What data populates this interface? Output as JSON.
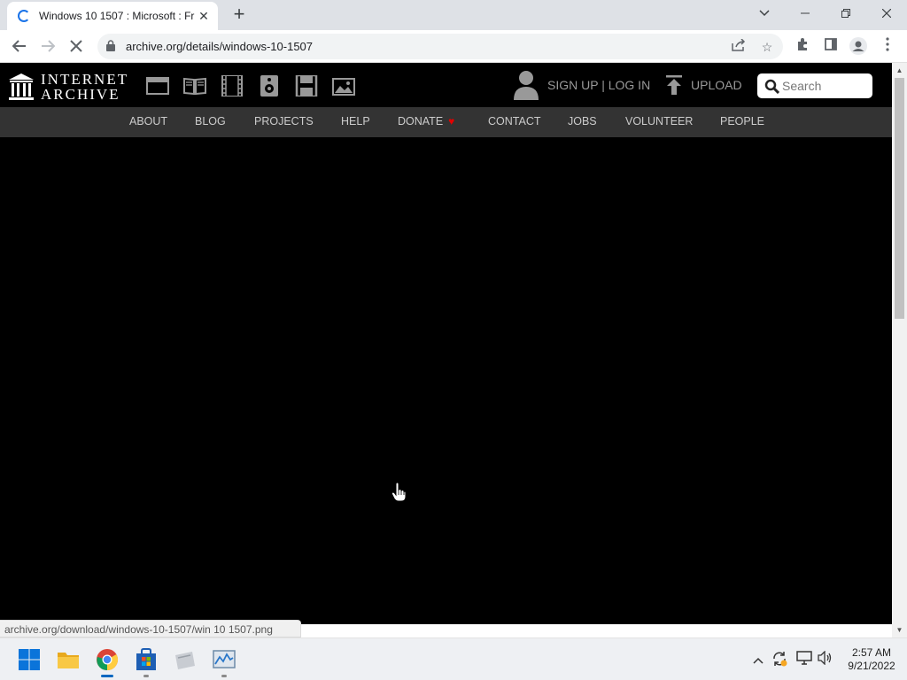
{
  "browser": {
    "tab_title": "Windows 10 1507 : Microsoft : Fr",
    "url": "archive.org/details/windows-10-1507",
    "status_url": "archive.org/download/windows-10-1507/win 10 1507.png"
  },
  "site": {
    "logo_line1": "INTERNET",
    "logo_line2": "ARCHIVE",
    "media_icons": [
      "web-icon",
      "texts-icon",
      "video-icon",
      "audio-icon",
      "software-icon",
      "images-icon"
    ],
    "signup_label": "SIGN UP | LOG IN",
    "upload_label": "UPLOAD",
    "search_placeholder": "Search",
    "nav": [
      "ABOUT",
      "BLOG",
      "PROJECTS",
      "HELP",
      "DONATE",
      "CONTACT",
      "JOBS",
      "VOLUNTEER",
      "PEOPLE"
    ],
    "donate_heart": "♥",
    "colors": {
      "header_bg": "#000000",
      "nav_bg": "#333333",
      "heart": "#e30000"
    }
  },
  "taskbar": {
    "apps": [
      "windows-start-icon",
      "file-explorer-icon",
      "chrome-icon",
      "microsoft-store-icon",
      "app-icon",
      "task-manager-icon"
    ],
    "time": "2:57 AM",
    "date": "9/21/2022"
  }
}
